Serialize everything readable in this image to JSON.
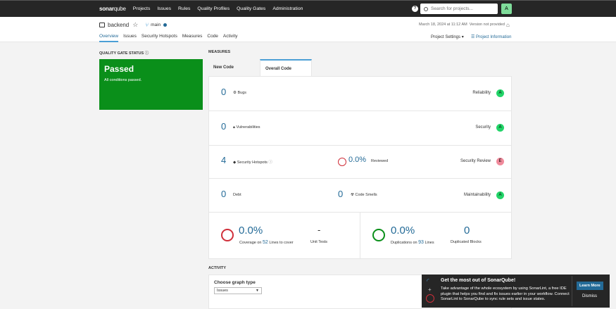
{
  "topbar": {
    "logo_bold": "sonar",
    "logo_light": "qube",
    "nav": [
      "Projects",
      "Issues",
      "Rules",
      "Quality Profiles",
      "Quality Gates",
      "Administration"
    ],
    "help_label": "?",
    "search_placeholder": "Search for projects...",
    "avatar": "A"
  },
  "project": {
    "name": "backend",
    "branch": "main",
    "date": "March 18, 2024 at 11:12 AM",
    "version": "Version not provided",
    "tabs": [
      "Overview",
      "Issues",
      "Security Hotspots",
      "Measures",
      "Code",
      "Activity"
    ],
    "settings": "Project Settings ▾",
    "info": "Project Information"
  },
  "quality_gate": {
    "label": "Quality Gate Status",
    "status": "Passed",
    "message": "All conditions passed."
  },
  "measures": {
    "label": "Measures",
    "tab_new": "New Code",
    "tab_overall": "Overall Code",
    "bugs": {
      "value": "0",
      "label": "Bugs",
      "category": "Reliability",
      "rating": "A"
    },
    "vulns": {
      "value": "0",
      "label": "Vulnerabilities",
      "category": "Security",
      "rating": "A"
    },
    "hotspots": {
      "value": "4",
      "label": "Security Hotspots",
      "reviewed_value": "0.0%",
      "reviewed_label": "Reviewed",
      "category": "Security Review",
      "rating": "E"
    },
    "debt": {
      "value": "0",
      "label": "Debt",
      "smells_value": "0",
      "smells_label": "Code Smells",
      "category": "Maintainability",
      "rating": "A"
    },
    "coverage": {
      "value": "0.0%",
      "prefix": "Coverage on",
      "lines": "52",
      "suffix": "Lines to cover"
    },
    "unit_tests": {
      "value": "-",
      "label": "Unit Tests"
    },
    "duplications": {
      "value": "0.0%",
      "prefix": "Duplications on",
      "lines": "93",
      "suffix": "Lines"
    },
    "dup_blocks": {
      "value": "0",
      "label": "Duplicated Blocks"
    }
  },
  "activity": {
    "label": "Activity",
    "graph_label": "Choose graph type",
    "graph_value": "Issues"
  },
  "toast": {
    "title": "Get the most out of SonarQube!",
    "body": "Take advantage of the whole ecosystem by using SonarLint, a free IDE plugin that helps you find and fix issues earlier in your workflow. Connect SonarLint to SonarQube to sync rule sets and issue states.",
    "learn_more": "Learn More",
    "dismiss": "Dismiss"
  },
  "colors": {
    "accent": "#236a97",
    "passed": "#0a8f1a",
    "rating_a": "#22d468",
    "rating_e": "#f08a9b",
    "ring": "#d02f3a",
    "ring_green": "#0a8f1a"
  }
}
